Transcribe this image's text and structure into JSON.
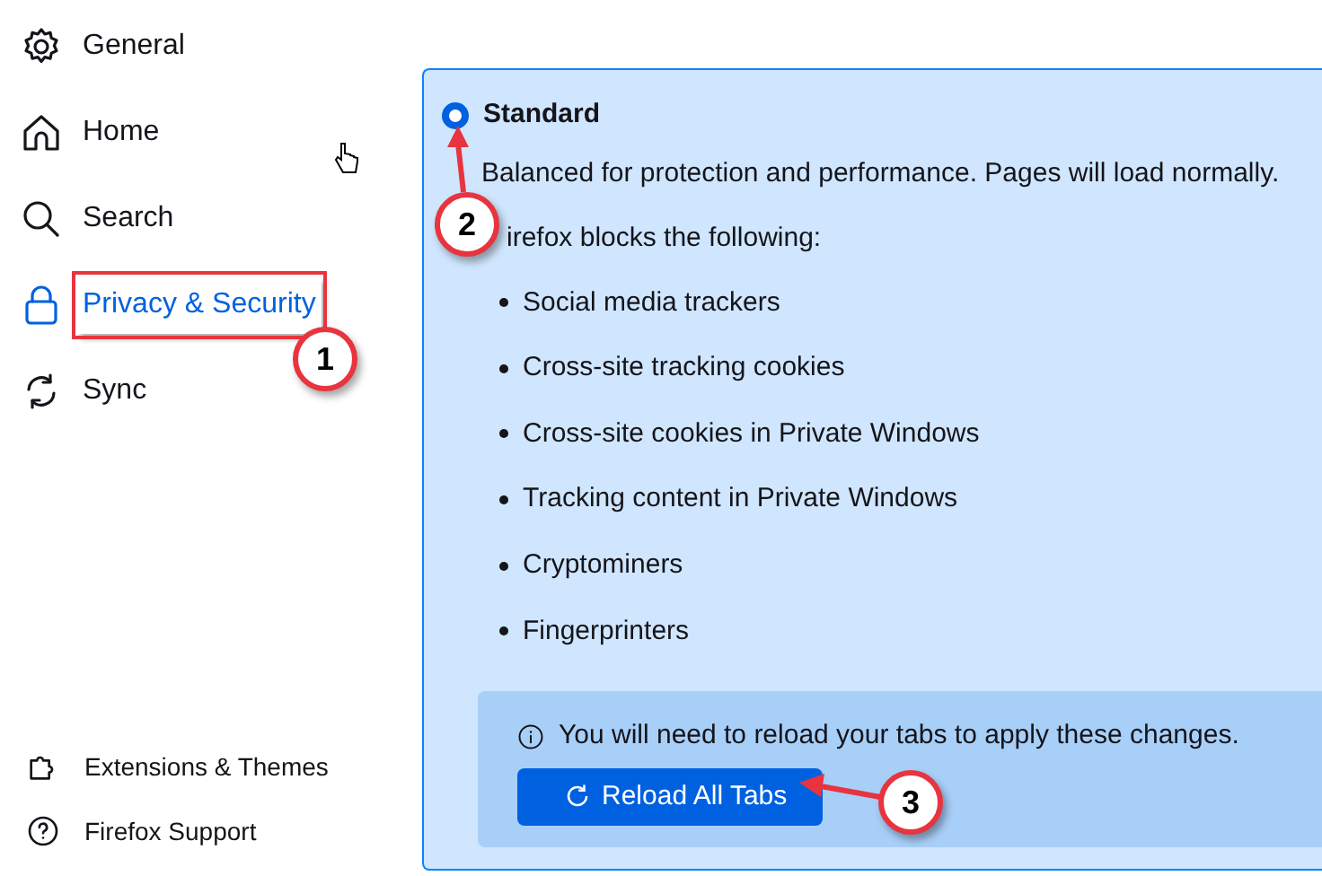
{
  "sidebar": {
    "items": [
      {
        "label": "General",
        "selected": false,
        "highlighted": false
      },
      {
        "label": "Home",
        "selected": false,
        "highlighted": false
      },
      {
        "label": "Search",
        "selected": false,
        "highlighted": false
      },
      {
        "label": "Privacy & Security",
        "selected": true,
        "highlighted": true
      },
      {
        "label": "Sync",
        "selected": false,
        "highlighted": false
      }
    ],
    "footer_items": [
      {
        "label": "Extensions & Themes"
      },
      {
        "label": "Firefox Support"
      }
    ]
  },
  "option": {
    "label": "Standard",
    "selected": true,
    "description": "Balanced for protection and performance. Pages will load normally.",
    "blocks_heading": "irefox blocks the following:",
    "blocked": [
      "Social media trackers",
      "Cross-site tracking cookies",
      "Cross-site cookies in Private Windows",
      "Tracking content in Private Windows",
      "Cryptominers",
      "Fingerprinters"
    ],
    "notice": {
      "text": "You will need to reload your tabs to apply these changes.",
      "button": "Reload All Tabs"
    }
  },
  "callouts": [
    {
      "number": "1"
    },
    {
      "number": "2"
    },
    {
      "number": "3"
    }
  ]
}
